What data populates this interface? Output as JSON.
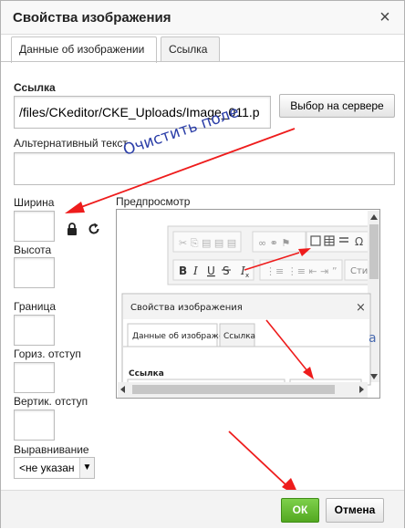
{
  "dialog": {
    "title": "Свойства изображения",
    "close_symbol": "×"
  },
  "tabs": [
    {
      "label": "Данные об изображении",
      "active": true
    },
    {
      "label": "Ссылка",
      "active": false
    }
  ],
  "form": {
    "url_label": "Ссылка",
    "url_value": "/files/CKeditor/CKE_Uploads/Image_011.p",
    "browse_button": "Выбор на сервере",
    "alt_label": "Альтернативный текст",
    "alt_value": "",
    "width_label": "Ширина",
    "height_label": "Высота",
    "border_label": "Граница",
    "hspace_label": "Гориз. отступ",
    "vspace_label": "Вертик. отступ",
    "align_label": "Выравнивание",
    "align_value": "<не указан"
  },
  "annotation": {
    "text": "Очистить поле",
    "color": "#2c3fa8",
    "arrow_color": "#ee1c1c"
  },
  "preview": {
    "label": "Предпросмотр",
    "inner_toolbar_styles_label": "Стили",
    "inner_dialog_title": "Свойства изображения",
    "inner_tab_1": "Данные об изображении",
    "inner_tab_2": "Ссылка",
    "inner_url_label": "Ссылка",
    "inner_close_symbol": "×"
  },
  "footer": {
    "ok_label": "ОК",
    "cancel_label": "Отмена",
    "ok_color": "#5cb82a"
  }
}
